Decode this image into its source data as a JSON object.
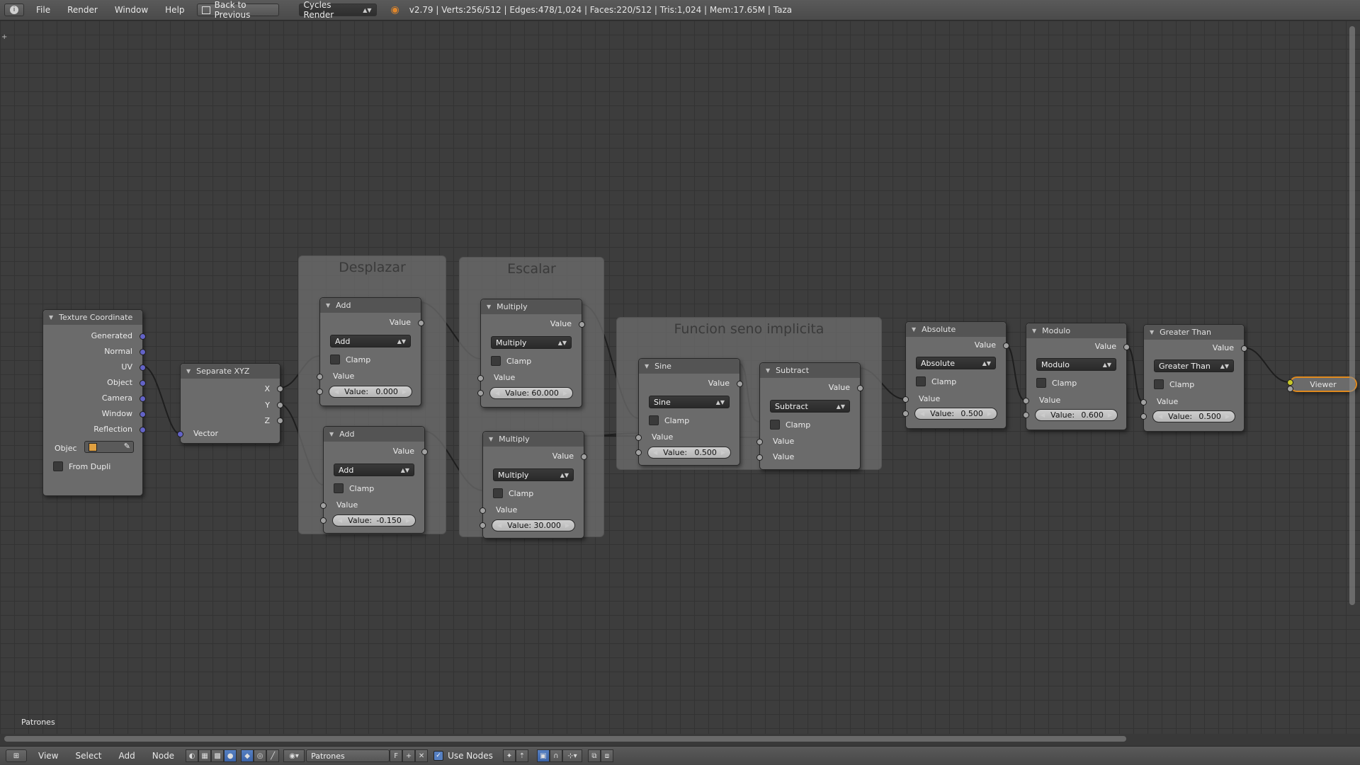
{
  "topbar": {
    "menus": [
      "File",
      "Render",
      "Window",
      "Help"
    ],
    "back_button": "Back to Previous",
    "engine": "Cycles Render",
    "stats": "v2.79 | Verts:256/512 | Edges:478/1,024 | Faces:220/512 | Tris:1,024 | Mem:17.65M | Taza"
  },
  "editor": {
    "material_label": "Patrones"
  },
  "frames": {
    "desplazar": "Desplazar",
    "escalar": "Escalar",
    "seno": "Funcion seno implicita"
  },
  "texcoord": {
    "title": "Texture Coordinate",
    "outputs": [
      "Generated",
      "Normal",
      "UV",
      "Object",
      "Camera",
      "Window",
      "Reflection"
    ],
    "object_label": "Objec",
    "from_dupli": "From Dupli"
  },
  "separate": {
    "title": "Separate XYZ",
    "outputs": [
      "X",
      "Y",
      "Z"
    ],
    "input": "Vector"
  },
  "common": {
    "value": "Value",
    "clamp": "Clamp",
    "value_field": "Value:"
  },
  "add1": {
    "title": "Add",
    "op": "Add",
    "val": "0.000"
  },
  "add2": {
    "title": "Add",
    "op": "Add",
    "val": "-0.150"
  },
  "mul1": {
    "title": "Multiply",
    "op": "Multiply",
    "val": "60.000"
  },
  "mul2": {
    "title": "Multiply",
    "op": "Multiply",
    "val": "30.000"
  },
  "sine": {
    "title": "Sine",
    "op": "Sine",
    "val": "0.500"
  },
  "sub": {
    "title": "Subtract",
    "op": "Subtract"
  },
  "abs": {
    "title": "Absolute",
    "op": "Absolute",
    "val": "0.500"
  },
  "mod": {
    "title": "Modulo",
    "op": "Modulo",
    "val": "0.600"
  },
  "gt": {
    "title": "Greater Than",
    "op": "Greater Than",
    "val": "0.500"
  },
  "viewer": {
    "title": "Viewer"
  },
  "bottombar": {
    "menus": [
      "View",
      "Select",
      "Add",
      "Node"
    ],
    "material": "Patrones",
    "fake_user": "F",
    "use_nodes": "Use Nodes"
  },
  "colors": {
    "background": "#393939",
    "node_body": "#6b6b6b",
    "vector_socket": "#6363c7",
    "value_socket": "#a1a1a1",
    "viewer_socket": "#c7c729",
    "viewer_border": "#e08a1e"
  }
}
